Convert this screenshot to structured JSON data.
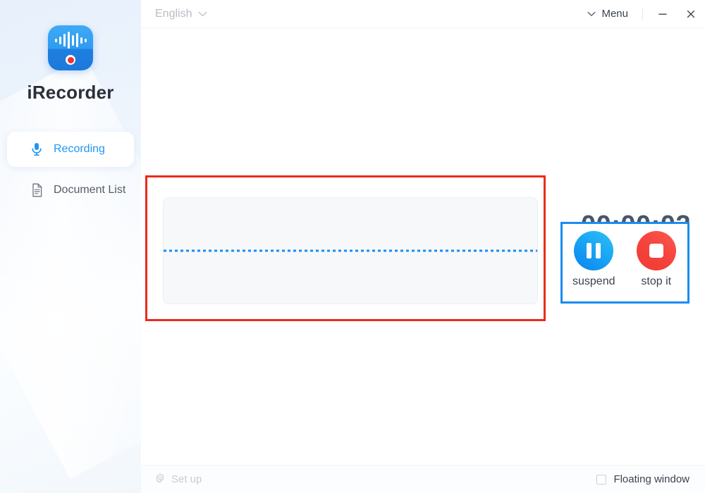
{
  "app": {
    "name": "iRecorder",
    "icon": "app-waveform-record-icon"
  },
  "sidebar": {
    "items": [
      {
        "label": "Recording",
        "icon": "microphone-icon",
        "active": true
      },
      {
        "label": "Document List",
        "icon": "document-icon",
        "active": false
      }
    ]
  },
  "titlebar": {
    "language": "English",
    "language_chevron": "chevron-down-icon",
    "menu_chevron": "chevron-down-icon",
    "menu": "Menu",
    "minimize": "minimize-icon",
    "close": "close-icon"
  },
  "main": {
    "waveform": {
      "baseline_color": "#1b8cf2",
      "panel_color": "#f6f8fa",
      "annotation_color": "#ee2a1c"
    },
    "timer": "00:00:02",
    "controls": {
      "annotation_color": "#1a8cf0",
      "suspend": {
        "label": "suspend",
        "icon": "pause-icon",
        "color": "#19a7f5"
      },
      "stop": {
        "label": "stop it",
        "icon": "stop-icon",
        "color": "#f5443c"
      }
    }
  },
  "bottombar": {
    "setup": "Set up",
    "setup_icon": "gear-icon",
    "floating_window": "Floating window",
    "floating_window_checked": false
  },
  "colors": {
    "accent_blue": "#2196f3",
    "record_red": "#e8352e",
    "timer_text": "#4a5568"
  }
}
